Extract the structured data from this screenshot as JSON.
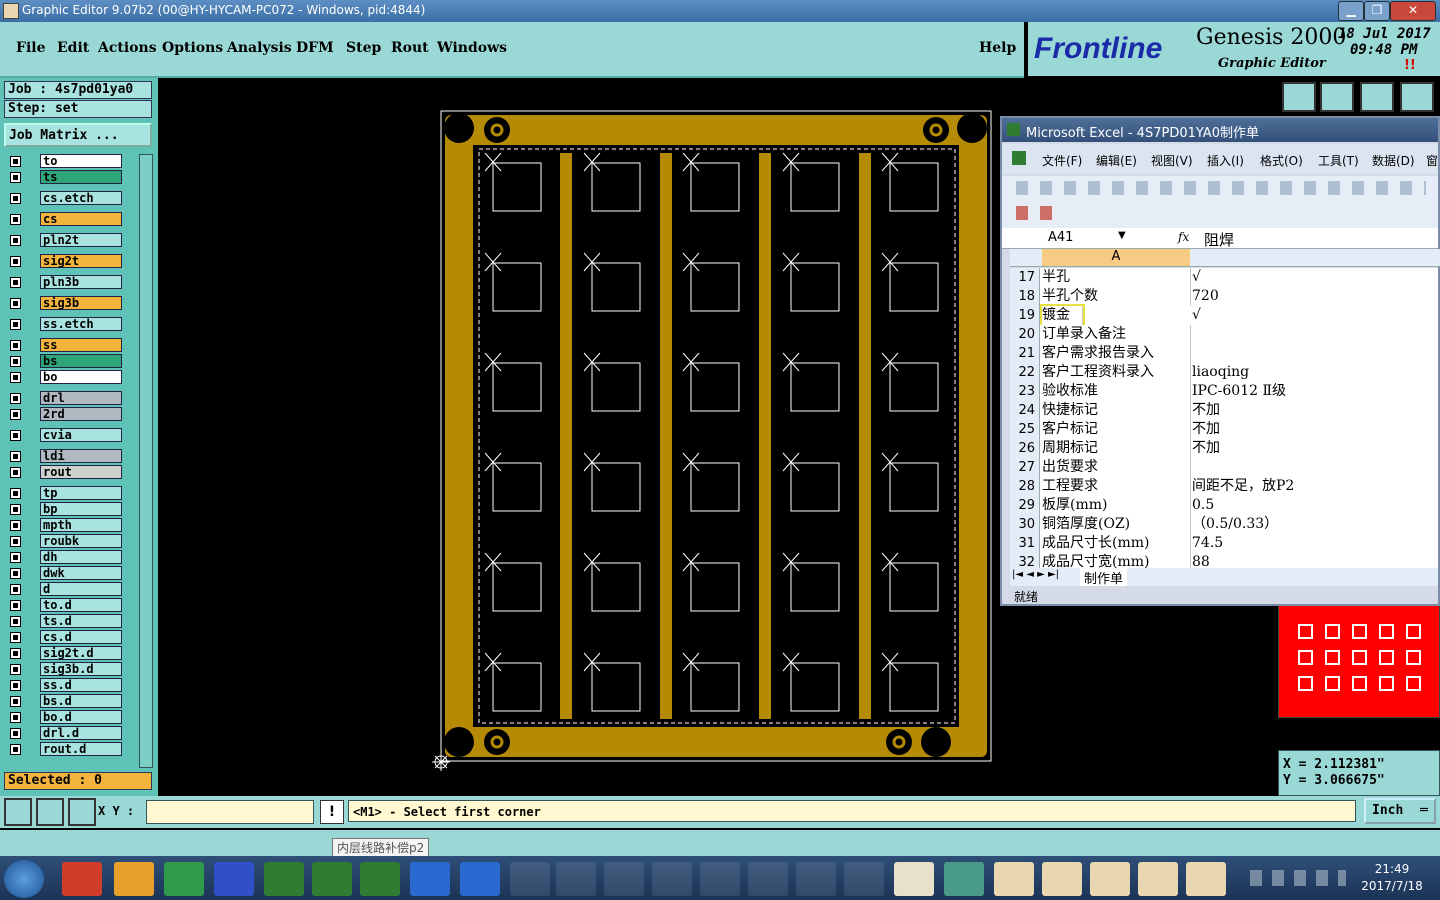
{
  "window": {
    "title": "Graphic Editor 9.07b2 (00@HY-HYCAM-PC072 - Windows, pid:4844)"
  },
  "menu": {
    "items": [
      "File",
      "Edit",
      "Actions",
      "Options",
      "Analysis",
      "DFM",
      "Step",
      "Rout",
      "Windows"
    ],
    "help": "Help"
  },
  "brand": {
    "logo": "Frontline",
    "product": "Genesis 2000",
    "subtitle": "Graphic Editor",
    "date": "18 Jul 2017",
    "time": "09:48 PM",
    "alert": "!!"
  },
  "job": {
    "job_label": "Job : 4s7pd01ya0",
    "step_label": "Step: set",
    "matrix_button": "Job Matrix ..."
  },
  "layers": [
    {
      "name": "to",
      "color": "#ffffff"
    },
    {
      "name": "ts",
      "color": "#2ea67a"
    },
    {
      "name": "cs.etch",
      "color": "#a9e3e0"
    },
    {
      "name": "cs",
      "color": "#f2b43c"
    },
    {
      "name": "pln2t",
      "color": "#a9e3e0"
    },
    {
      "name": "sig2t",
      "color": "#f2b43c"
    },
    {
      "name": "pln3b",
      "color": "#a9e3e0"
    },
    {
      "name": "sig3b",
      "color": "#f2b43c"
    },
    {
      "name": "ss.etch",
      "color": "#a9e3e0"
    },
    {
      "name": "ss",
      "color": "#f2b43c"
    },
    {
      "name": "bs",
      "color": "#2ea67a"
    },
    {
      "name": "bo",
      "color": "#ffffff"
    },
    {
      "name": "drl",
      "color": "#b0b8c0"
    },
    {
      "name": "2rd",
      "color": "#b0b8c0"
    },
    {
      "name": "cvia",
      "color": "#a9e3e0"
    },
    {
      "name": "ldi",
      "color": "#b0b8c0"
    },
    {
      "name": "rout",
      "color": "#d0d0d0"
    },
    {
      "name": "tp",
      "color": "#a9e3e0"
    },
    {
      "name": "bp",
      "color": "#a9e3e0"
    },
    {
      "name": "mpth",
      "color": "#a9e3e0"
    },
    {
      "name": "roubk",
      "color": "#a9e3e0"
    },
    {
      "name": "dh",
      "color": "#a9e3e0"
    },
    {
      "name": "dwk",
      "color": "#a9e3e0"
    },
    {
      "name": "d",
      "color": "#a9e3e0"
    },
    {
      "name": "to.d",
      "color": "#a9e3e0"
    },
    {
      "name": "ts.d",
      "color": "#a9e3e0"
    },
    {
      "name": "cs.d",
      "color": "#a9e3e0"
    },
    {
      "name": "sig2t.d",
      "color": "#a9e3e0"
    },
    {
      "name": "sig3b.d",
      "color": "#a9e3e0"
    },
    {
      "name": "ss.d",
      "color": "#a9e3e0"
    },
    {
      "name": "bs.d",
      "color": "#a9e3e0"
    },
    {
      "name": "bo.d",
      "color": "#a9e3e0"
    },
    {
      "name": "drl.d",
      "color": "#a9e3e0"
    },
    {
      "name": "rout.d",
      "color": "#a9e3e0"
    }
  ],
  "selected": "Selected : 0",
  "excel": {
    "title": "Microsoft Excel - 4S7PD01YA0制作单",
    "menu": [
      "文件(F)",
      "编辑(E)",
      "视图(V)",
      "插入(I)",
      "格式(O)",
      "工具(T)",
      "数据(D)",
      "窗"
    ],
    "cell_ref": "A41",
    "fx": "fx",
    "formula": "阻焊",
    "col_header": "A",
    "rows": [
      {
        "n": "17",
        "a": "半孔",
        "b": "√"
      },
      {
        "n": "18",
        "a": "半孔个数",
        "b": "720"
      },
      {
        "n": "19",
        "a": "镀金",
        "b": "√"
      },
      {
        "n": "20",
        "a": "订单录入备注",
        "b": ""
      },
      {
        "n": "21",
        "a": "客户需求报告录入",
        "b": ""
      },
      {
        "n": "22",
        "a": "客户工程资料录入",
        "b": "liaoqing"
      },
      {
        "n": "23",
        "a": "验收标准",
        "b": "IPC-6012 Ⅱ级"
      },
      {
        "n": "24",
        "a": "快捷标记",
        "b": "不加"
      },
      {
        "n": "25",
        "a": "客户标记",
        "b": "不加"
      },
      {
        "n": "26",
        "a": "周期标记",
        "b": "不加"
      },
      {
        "n": "27",
        "a": "出货要求",
        "b": ""
      },
      {
        "n": "28",
        "a": "工程要求",
        "b": "间距不足，放P2"
      },
      {
        "n": "29",
        "a": "板厚(mm)",
        "b": "0.5"
      },
      {
        "n": "30",
        "a": "铜箔厚度(OZ)",
        "b": "（0.5/0.33）"
      },
      {
        "n": "31",
        "a": "成品尺寸长(mm)",
        "b": "74.5"
      },
      {
        "n": "32",
        "a": "成品尺寸宽(mm)",
        "b": "88"
      }
    ],
    "sheet_tab": "制作单",
    "status": "就绪"
  },
  "coords": {
    "x": "X = 2.112381\"",
    "y": "Y = 3.066675\""
  },
  "status": {
    "xy_label": "X Y :",
    "xy_value": "",
    "message": "<M1> - Select first corner",
    "units": "Inch"
  },
  "tooltip": "内层线路补偿p2",
  "clock": {
    "time": "21:49",
    "date": "2017/7/18"
  },
  "colors": {
    "copper": "#b58a05",
    "panel_bg": "#9ad8d6",
    "red_preview": "#ff0000"
  }
}
